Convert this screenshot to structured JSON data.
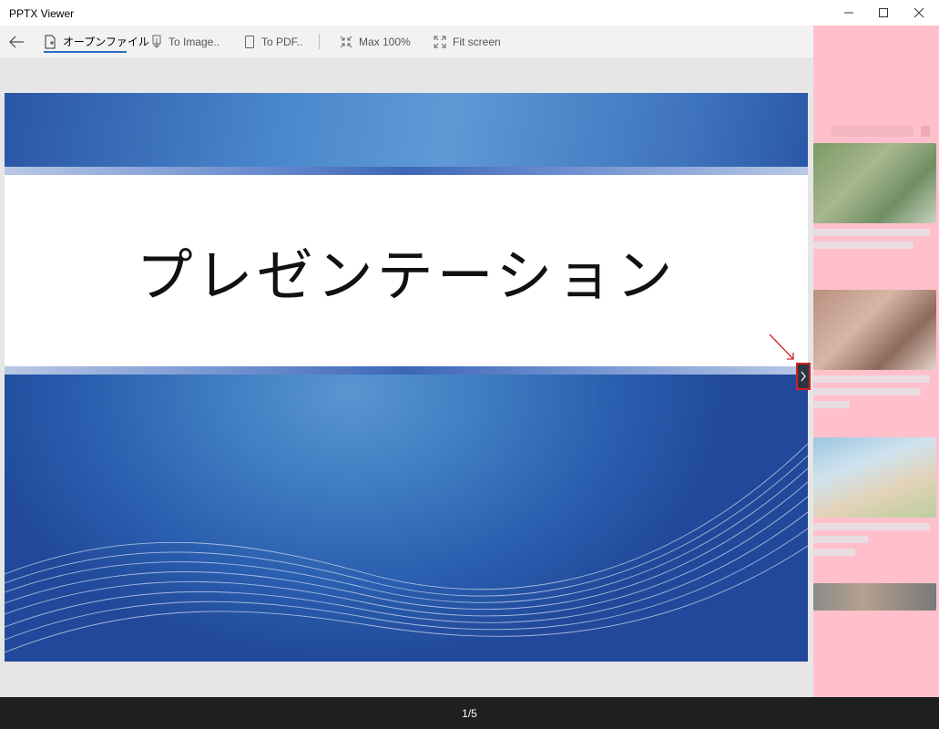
{
  "window": {
    "title": "PPTX Viewer",
    "controls": [
      "minimize",
      "maximize",
      "close"
    ]
  },
  "toolbar": {
    "back_icon": "back-arrow-icon",
    "items": [
      {
        "label": "オープンファイル",
        "icon": "open-file-icon",
        "active": true
      },
      {
        "label": "To Image..",
        "icon": "image-export-icon"
      },
      {
        "label": "To PDF..",
        "icon": "pdf-export-icon"
      },
      {
        "label": "Max 100%",
        "icon": "shrink-icon"
      },
      {
        "label": "Fit screen",
        "icon": "expand-icon"
      }
    ]
  },
  "slide": {
    "title": "プレゼンテーション"
  },
  "next_button": {
    "icon": "chevron-right-icon"
  },
  "status": {
    "page": "1/5"
  },
  "colors": {
    "accent": "#2b6cc4",
    "slide_blue": "#2a5eaf",
    "ad_bg": "#ffc0cb",
    "status_bg": "#1f1f1f",
    "highlight": "#d32121"
  }
}
